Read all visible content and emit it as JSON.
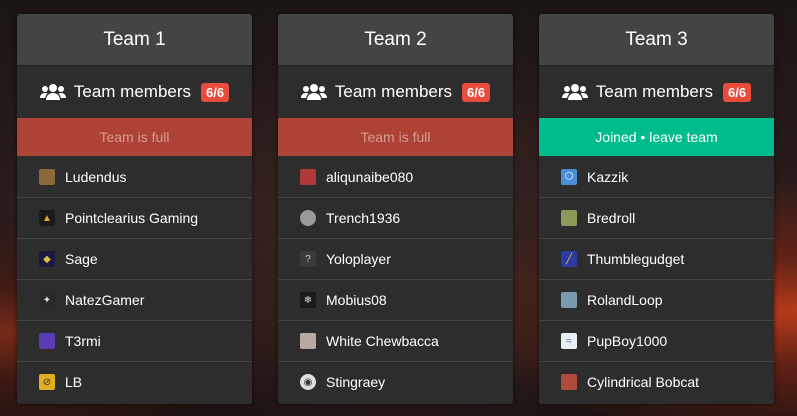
{
  "teams": [
    {
      "title": "Team 1",
      "members_label": "Team members",
      "count": "6/6",
      "status": "Team is full",
      "members": [
        {
          "name": "Ludendus",
          "avatar_color": "#8a6a3a"
        },
        {
          "name": "Pointclearius Gaming",
          "avatar_color": "#c8a02a"
        },
        {
          "name": "Sage",
          "avatar_color": "#c9a632"
        },
        {
          "name": "NatezGamer",
          "avatar_color": "#cfcfcf"
        },
        {
          "name": "T3rmi",
          "avatar_color": "#5a3cb8"
        },
        {
          "name": "LB",
          "avatar_color": "#e0b020"
        }
      ]
    },
    {
      "title": "Team 2",
      "members_label": "Team members",
      "count": "6/6",
      "status": "Team is full",
      "members": [
        {
          "name": "aliqunaibe080",
          "avatar_color": "#b03a3a"
        },
        {
          "name": "Trench1936",
          "avatar_color": "#9a9a9a"
        },
        {
          "name": "Yoloplayer",
          "avatar_color": "#3a3a3a"
        },
        {
          "name": "Mobius08",
          "avatar_color": "#555555"
        },
        {
          "name": "White Chewbacca",
          "avatar_color": "#b8a8a0"
        },
        {
          "name": "Stingraey",
          "avatar_color": "#dddddd"
        }
      ]
    },
    {
      "title": "Team 3",
      "members_label": "Team members",
      "count": "6/6",
      "status": "Joined • leave team",
      "members": [
        {
          "name": "Kazzik",
          "avatar_color": "#4a90d9"
        },
        {
          "name": "Bredroll",
          "avatar_color": "#8a9a5a"
        },
        {
          "name": "Thumblegudget",
          "avatar_color": "#2a3ca0"
        },
        {
          "name": "RolandLoop",
          "avatar_color": "#7a9ab0"
        },
        {
          "name": "PupBoy1000",
          "avatar_color": "#e8eef5"
        },
        {
          "name": "Cylindrical Bobcat",
          "avatar_color": "#b04a3a"
        }
      ]
    }
  ],
  "colors": {
    "full": "#ad4336",
    "joined": "#00bc8c",
    "badge": "#e74c3c"
  },
  "icons": {
    "members": "users-icon"
  }
}
